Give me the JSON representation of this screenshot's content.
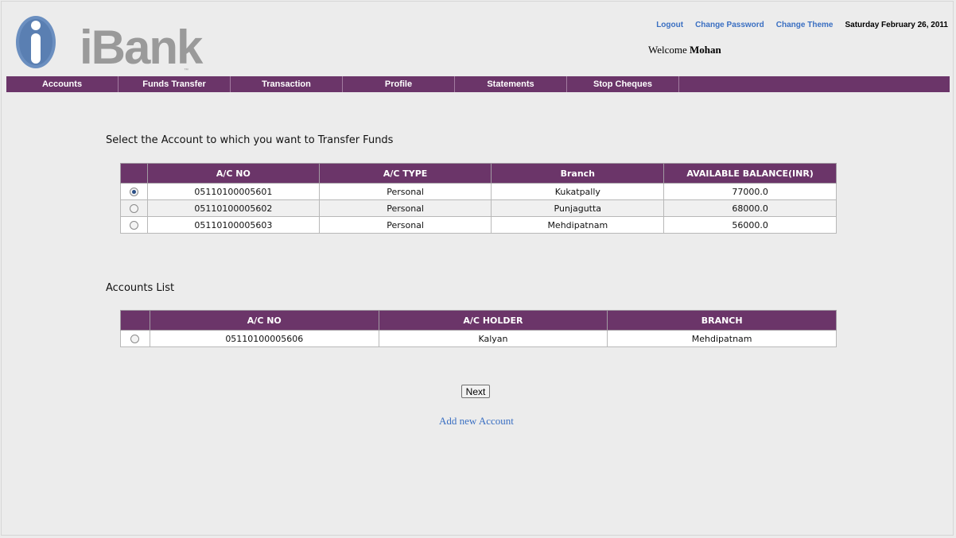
{
  "header": {
    "logo_text": "iBank",
    "logo_tm": "™",
    "links": [
      "Logout",
      "Change Password",
      "Change Theme"
    ],
    "date": "Saturday February 26, 2011",
    "welcome_label": "Welcome",
    "user_name": "Mohan"
  },
  "nav": [
    "Accounts",
    "Funds Transfer",
    "Transaction",
    "Profile",
    "Statements",
    "Stop Cheques",
    ""
  ],
  "transfer": {
    "title": "Select the Account to which you want to Transfer Funds",
    "columns": [
      "A/C NO",
      "A/C TYPE",
      "Branch",
      "AVAILABLE BALANCE(INR)"
    ],
    "rows": [
      {
        "ac_no": "05110100005601",
        "type": "Personal",
        "branch": "Kukatpally",
        "balance": "77000.0",
        "selected": true
      },
      {
        "ac_no": "05110100005602",
        "type": "Personal",
        "branch": "Punjagutta",
        "balance": "68000.0",
        "selected": false
      },
      {
        "ac_no": "05110100005603",
        "type": "Personal",
        "branch": "Mehdipatnam",
        "balance": "56000.0",
        "selected": false
      }
    ]
  },
  "accounts_list": {
    "title": "Accounts List",
    "columns": [
      "A/C NO",
      "A/C HOLDER",
      "BRANCH"
    ],
    "rows": [
      {
        "ac_no": "05110100005606",
        "holder": "Kalyan",
        "branch": "Mehdipatnam",
        "selected": false
      }
    ]
  },
  "actions": {
    "next_label": "Next",
    "add_account_label": "Add new Account"
  },
  "colors": {
    "brand": "#6b3569",
    "link": "#3a6fc2",
    "background": "#ececec"
  }
}
